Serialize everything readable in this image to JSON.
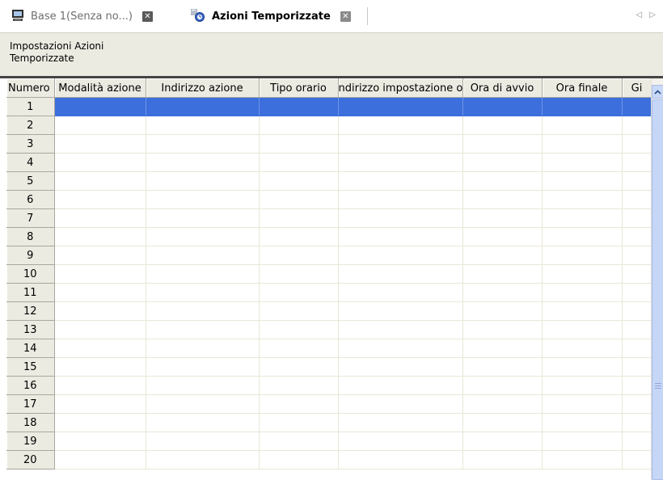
{
  "tabs": [
    {
      "label": "Base 1(Senza no...)",
      "icon": "monitor-icon",
      "active": false
    },
    {
      "label": "Azioni Temporizzate",
      "icon": "timed-action-icon",
      "active": true
    }
  ],
  "tab_close_glyph": "✕",
  "tab_scroll_glyph": "◁ ▷",
  "toolbar": {
    "button_line1": "Impostazioni Azioni",
    "button_line2": "Temporizzate"
  },
  "table": {
    "columns": [
      "Numero",
      "Modalità azione",
      "Indirizzo azione",
      "Tipo orario",
      "ndirizzo impostazione or",
      "Ora di avvio",
      "Ora finale",
      "Gi"
    ],
    "rows": [
      "1",
      "2",
      "3",
      "4",
      "5",
      "6",
      "7",
      "8",
      "9",
      "10",
      "11",
      "12",
      "13",
      "14",
      "15",
      "16",
      "17",
      "18",
      "19",
      "20"
    ],
    "selected_row": 1
  },
  "colors": {
    "selection": "#3c6fdc",
    "toolbar_bg": "#ecebe2",
    "scrollbar_thumb": "#c6d6f7"
  }
}
